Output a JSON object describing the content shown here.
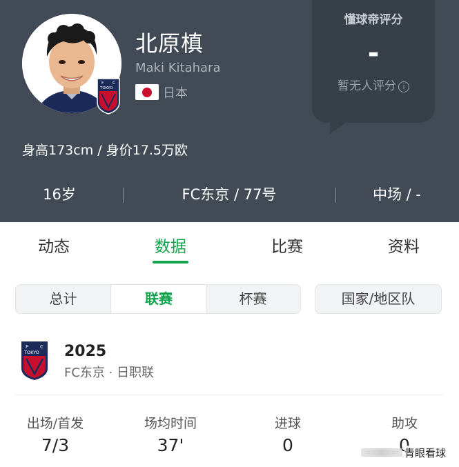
{
  "player": {
    "name": "北原槙",
    "name_en": "Maki Kitahara",
    "country": "日本",
    "flag": "japan-flag",
    "height_value": "身高173cm / 身价17.5万欧"
  },
  "rating": {
    "title": "懂球帝评分",
    "value": "-",
    "note": "暂无人评分"
  },
  "facts": {
    "age": "16岁",
    "club": "FC东京 / 77号",
    "position": "中场 / -"
  },
  "tabs": [
    "动态",
    "数据",
    "比赛",
    "资料"
  ],
  "active_tab": "数据",
  "segment": [
    "总计",
    "联赛",
    "杯赛"
  ],
  "active_segment": "联赛",
  "national_team_label": "国家/地区队",
  "season": {
    "badge_text": "FC TOKYO",
    "year": "2025",
    "league": "FC东京 · 日职联"
  },
  "stats": [
    {
      "label": "出场/首发",
      "value": "7/3"
    },
    {
      "label": "场均时间",
      "value": "37'"
    },
    {
      "label": "进球",
      "value": "0"
    },
    {
      "label": "助攻",
      "value": "0"
    }
  ],
  "watermark": "青眼看球",
  "colors": {
    "header_bg": "#414a55",
    "accent_green": "#13a34d",
    "club_navy": "#1c2a5a",
    "club_red": "#c8102e"
  }
}
